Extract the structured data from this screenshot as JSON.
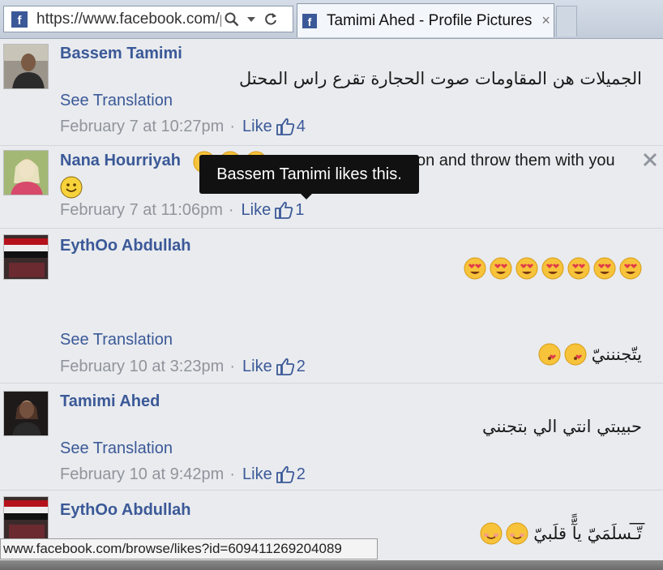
{
  "browser": {
    "url": "https://www.facebook.com/p",
    "tab_title": "Tamimi Ahed - Profile Pictures",
    "tab_close": "×",
    "favicon_letter": "f",
    "icons": [
      "search-icon",
      "dropdown-icon",
      "refresh-icon",
      "close-icon"
    ]
  },
  "comments": [
    {
      "author": "Bassem Tamimi",
      "text": "الجميلات هن المقاومات صوت الحجارة تقرع راس المحتل",
      "see_translation": "See Translation",
      "date": "February 7 at 10:27pm",
      "like_label": "Like",
      "like_count": "4"
    },
    {
      "author": "Nana Hourriyah",
      "text_visible_tail": "on and throw them with you",
      "date": "February 7 at 11:06pm",
      "like_label": "Like",
      "like_count": "1"
    },
    {
      "author": "EythOo Abdullah",
      "text": "يتّجنننيّ",
      "see_translation": "See Translation",
      "date": "February 10 at 3:23pm",
      "like_label": "Like",
      "like_count": "2"
    },
    {
      "author": "Tamimi Ahed",
      "text": "حبيبتي انتي الي بتجنني",
      "see_translation": "See Translation",
      "date": "February 10 at 9:42pm",
      "like_label": "Like",
      "like_count": "2"
    },
    {
      "author": "EythOo Abdullah",
      "text": "تّ͞͞͞ـسلَمَيّ يآًّ قلَبيّ"
    }
  ],
  "separator": "·",
  "tooltip": "Bassem Tamimi likes this.",
  "status_bar": "www.facebook.com/browse/likes?id=609411269204089",
  "colors": {
    "link": "#3b5998",
    "meta": "#90949c",
    "background": "#e9ebee",
    "tooltip_bg": "#111111"
  }
}
